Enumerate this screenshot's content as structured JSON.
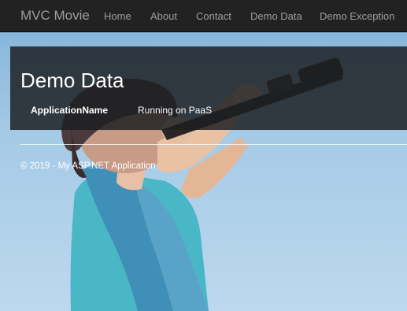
{
  "navbar": {
    "brand": "MVC Movie",
    "items": [
      {
        "label": "Home"
      },
      {
        "label": "About"
      },
      {
        "label": "Contact"
      },
      {
        "label": "Demo Data"
      },
      {
        "label": "Demo Exception"
      }
    ]
  },
  "main": {
    "title": "Demo Data",
    "rows": [
      {
        "key": "ApplicationName",
        "value": "Running on PaaS"
      }
    ]
  },
  "footer": {
    "text": "© 2019 - My ASP.NET Application"
  },
  "colors": {
    "navbar_bg": "#222222",
    "nav_text": "#9d9d9d",
    "panel_bg": "#1c1e20",
    "text": "#ffffff"
  }
}
